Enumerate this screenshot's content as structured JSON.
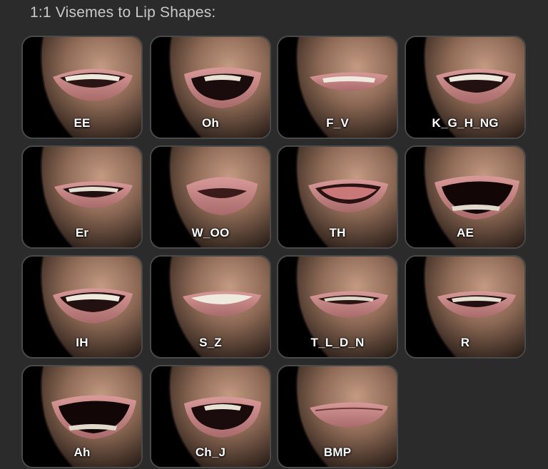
{
  "panel": {
    "title": "1:1 Visemes to Lip Shapes:"
  },
  "visemes": [
    {
      "label": "EE",
      "mouth": "smile-teeth"
    },
    {
      "label": "Oh",
      "mouth": "open-round"
    },
    {
      "label": "F_V",
      "mouth": "lip-bite"
    },
    {
      "label": "K_G_H_NG",
      "mouth": "open-teeth"
    },
    {
      "label": "Er",
      "mouth": "small-teeth"
    },
    {
      "label": "W_OO",
      "mouth": "pucker"
    },
    {
      "label": "TH",
      "mouth": "tongue"
    },
    {
      "label": "AE",
      "mouth": "wide-open"
    },
    {
      "label": "IH",
      "mouth": "open-teeth"
    },
    {
      "label": "S_Z",
      "mouth": "teeth-closed"
    },
    {
      "label": "T_L_D_N",
      "mouth": "slight-open"
    },
    {
      "label": "R",
      "mouth": "small-teeth"
    },
    {
      "label": "Ah",
      "mouth": "wide-open"
    },
    {
      "label": "Ch_J",
      "mouth": "open-round"
    },
    {
      "label": "BMP",
      "mouth": "closed"
    }
  ],
  "colors": {
    "background": "#2b2b2b",
    "tile_border": "#4a4a4a",
    "skin_light": "#b08a74",
    "skin_dark": "#3a2a22",
    "lip": "#c88a8a",
    "label": "#ffffff"
  }
}
